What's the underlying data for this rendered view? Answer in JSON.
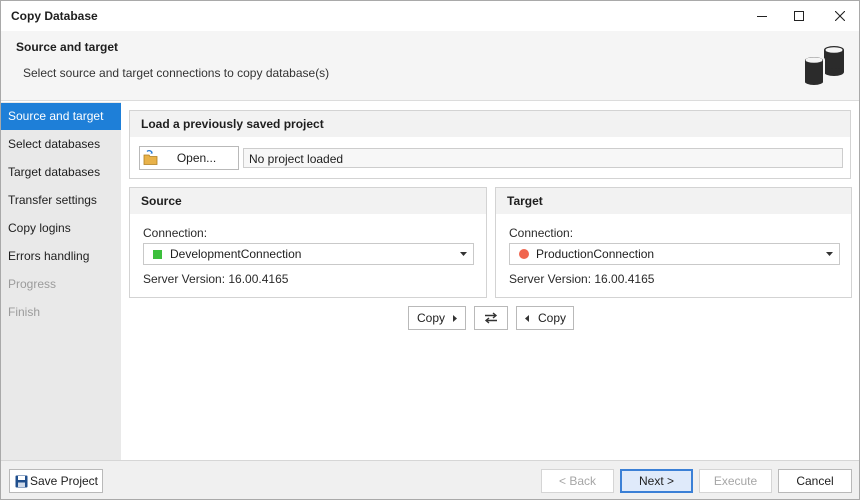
{
  "window": {
    "title": "Copy Database"
  },
  "header": {
    "title": "Source and target",
    "subtitle": "Select source and target connections to copy database(s)"
  },
  "sidebar": {
    "items": [
      {
        "label": "Source and target",
        "state": "active"
      },
      {
        "label": "Select databases",
        "state": "normal"
      },
      {
        "label": "Target databases",
        "state": "normal"
      },
      {
        "label": "Transfer settings",
        "state": "normal"
      },
      {
        "label": "Copy logins",
        "state": "normal"
      },
      {
        "label": "Errors handling",
        "state": "normal"
      },
      {
        "label": "Progress",
        "state": "disabled"
      },
      {
        "label": "Finish",
        "state": "disabled"
      }
    ]
  },
  "project": {
    "group_title": "Load a previously saved project",
    "open_label": "Open...",
    "status_value": "No project loaded"
  },
  "source": {
    "group_title": "Source",
    "connection_label": "Connection:",
    "connection_value": "DevelopmentConnection",
    "connection_color": "#3cbf3c",
    "version_label": "Server Version: 16.00.4165"
  },
  "target": {
    "group_title": "Target",
    "connection_label": "Connection:",
    "connection_value": "ProductionConnection",
    "connection_color": "#f0654e",
    "version_label": "Server Version: 16.00.4165"
  },
  "copy_controls": {
    "copy_right_label": "Copy",
    "copy_left_label": "Copy"
  },
  "footer": {
    "save_project_label": "Save Project",
    "back_label": "< Back",
    "next_label": "Next >",
    "execute_label": "Execute",
    "cancel_label": "Cancel"
  },
  "colors": {
    "accent": "#1e7fd8",
    "sidebar_bg": "#e9e9e9"
  }
}
